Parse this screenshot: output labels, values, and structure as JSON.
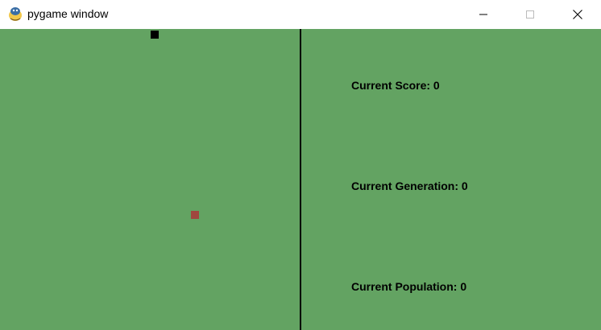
{
  "window": {
    "title": "pygame window",
    "app_icon": "pygame-snake-icon"
  },
  "controls": {
    "minimize_icon": "minimize-icon",
    "maximize_icon": "maximize-icon",
    "close_icon": "close-icon"
  },
  "game": {
    "background_color": "#63a362",
    "snake_color": "#000000",
    "food_color": "#a0473e"
  },
  "stats": {
    "score": "Current Score: 0",
    "generation": "Current Generation: 0",
    "population": "Current Population: 0"
  }
}
